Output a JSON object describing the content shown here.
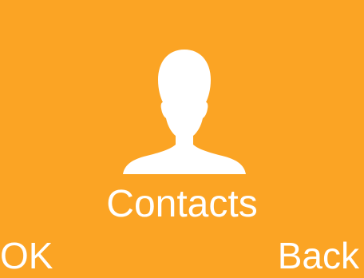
{
  "screen": {
    "background_color": "#FBA424",
    "foreground_color": "#FFFFFF"
  },
  "menu": {
    "icon": "contact-person-icon",
    "label": "Contacts"
  },
  "softkeys": {
    "left_label": "OK",
    "right_label": "Back"
  }
}
